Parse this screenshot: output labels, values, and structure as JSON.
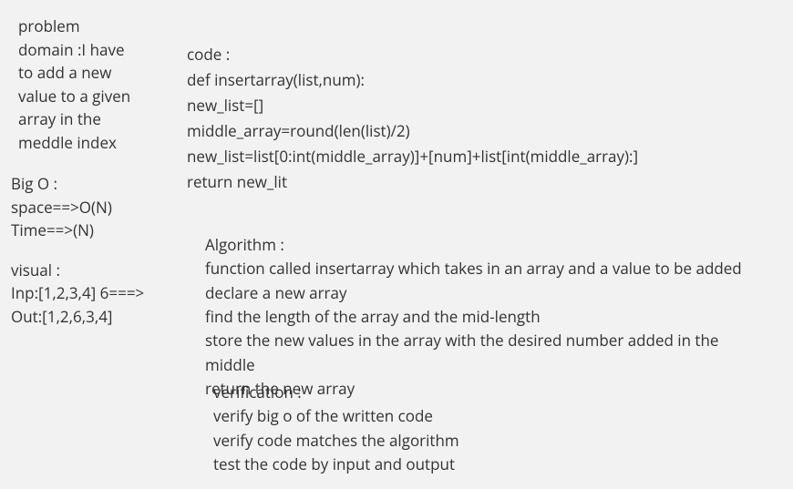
{
  "problem": {
    "l1": "problem",
    "l2": "domain :I have",
    "l3": "to add a new",
    "l4": "value to a given",
    "l5": "array in the",
    "l6": "meddle index"
  },
  "bigo": {
    "l1": "Big O :",
    "l2": "space==>O(N)",
    "l3": "Time==>(N)"
  },
  "visual": {
    "l1": "visual :",
    "l2": "Inp:[1,2,3,4] 6===>",
    "l3": "Out:[1,2,6,3,4]"
  },
  "code": {
    "l1": "code :",
    "l2": "def insertarray(list,num):",
    "l3": "new_list=[]",
    "l4": "middle_array=round(len(list)/2)",
    "l5": "new_list=list[0:int(middle_array)]+[num]+list[int(middle_array):]",
    "l6": "return new_lit"
  },
  "algo": {
    "l1": "Algorithm :",
    "l2": "function called insertarray which takes in an array and a value to be added",
    "l3": "declare a new array",
    "l4": "find the length of the array and the mid-length",
    "l5": "store the new values in the array with the desired number added in the middle",
    "l6": "return the new array"
  },
  "verif": {
    "l1": "verification :",
    "l2": "verify big o of the written code",
    "l3": "verify code matches the algorithm",
    "l4": "test the code by input and output"
  }
}
